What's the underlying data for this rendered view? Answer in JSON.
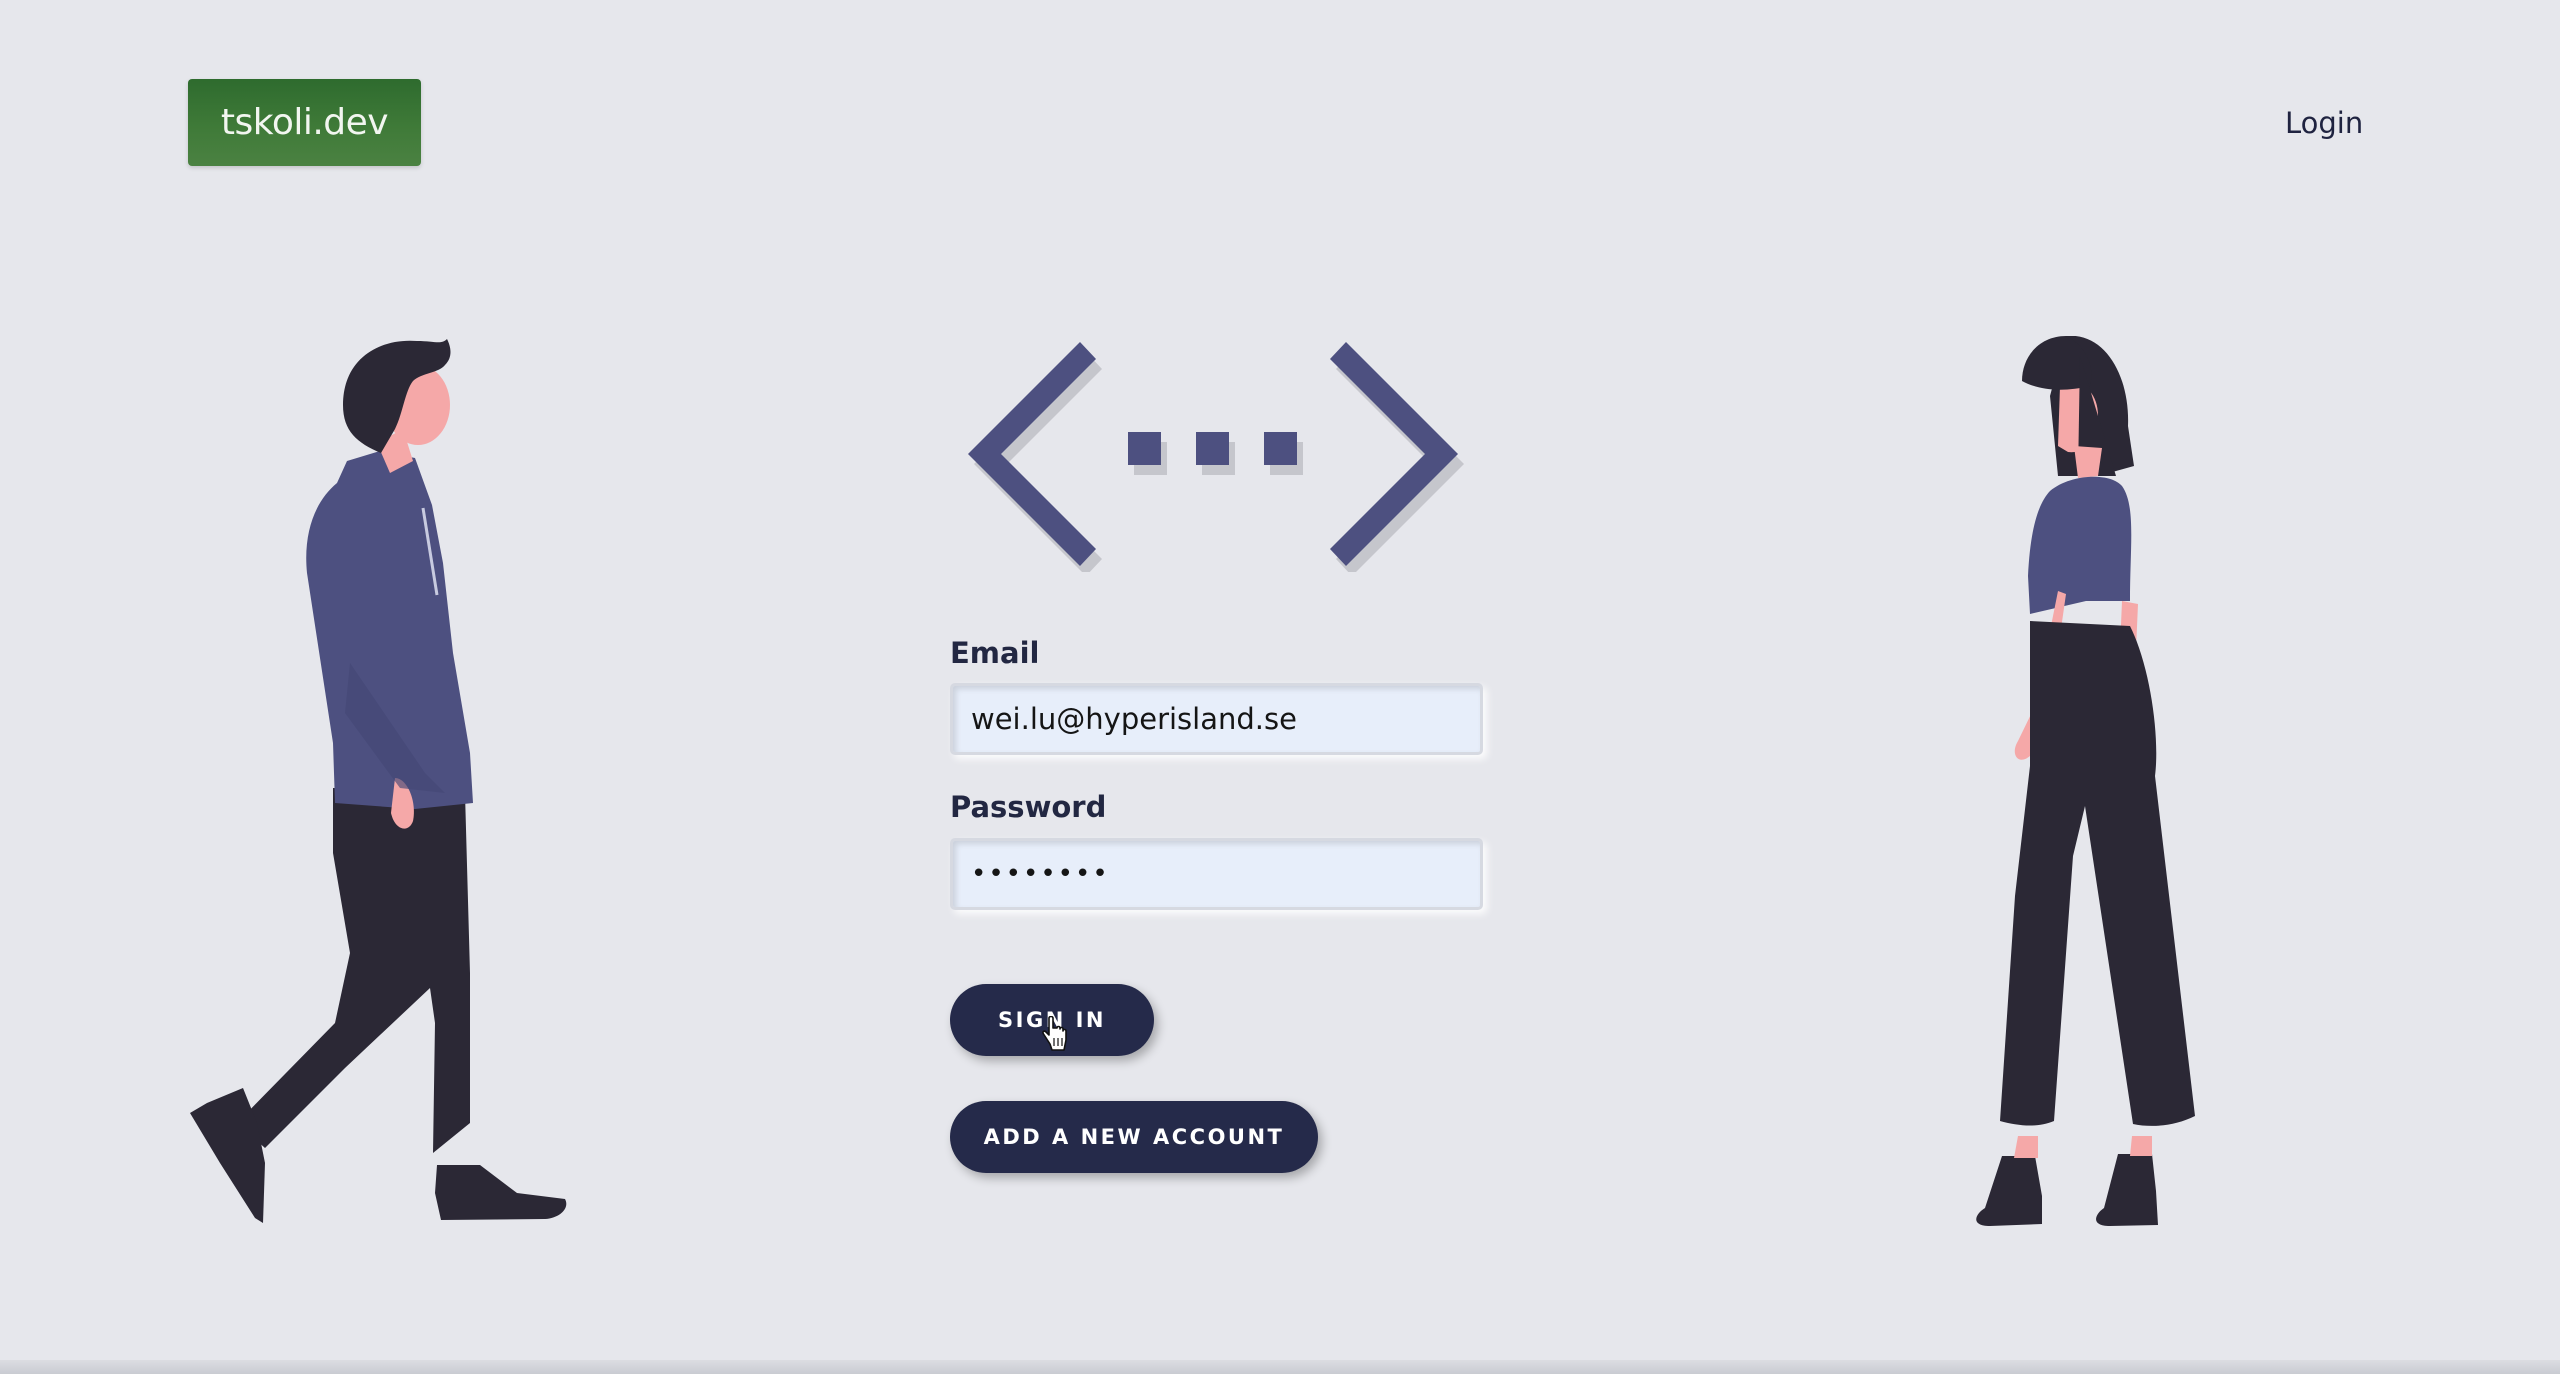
{
  "header": {
    "logo_text": "tskoli.dev",
    "nav_login": "Login"
  },
  "form": {
    "email_label": "Email",
    "email_value": "wei.lu@hyperisland.se",
    "password_label": "Password",
    "password_masked": "••••••••",
    "sign_in_label": "SIGN IN",
    "add_account_label": "ADD A NEW ACCOUNT"
  },
  "icons": {
    "brand": "code-brackets-icon",
    "cursor": "hand-pointer-icon"
  },
  "colors": {
    "background": "#e6e7ec",
    "logo_green": "#3f7a38",
    "button_navy": "#252a4a",
    "brand_purple": "#4d5080",
    "figure_dark": "#2b2835",
    "skin": "#f5a8a8"
  }
}
